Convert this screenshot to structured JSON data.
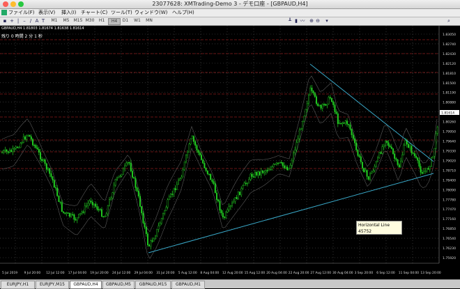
{
  "window": {
    "title": "23077628: XMTrading-Demo 3 - デモ口座 - [GBPAUD,H4]"
  },
  "menu": [
    {
      "label": "ファイル(F)"
    },
    {
      "label": "表示(V)"
    },
    {
      "label": "挿入(I)"
    },
    {
      "label": "チャート(C)"
    },
    {
      "label": "ツール(T)"
    },
    {
      "label": "ウィンドウ(W)"
    },
    {
      "label": "ヘルプ(H)"
    }
  ],
  "toolbar": {
    "timeframes": [
      "M1",
      "M5",
      "M15",
      "M30",
      "H1",
      "H4",
      "D1",
      "W1",
      "MN"
    ],
    "active_timeframe": "H4"
  },
  "chart": {
    "symbol_info": "GBPAUD,H4  1.81803  1.81674  1.81638  1.81614",
    "countdown": "残り 0 時間 2 分 1 秒",
    "price_labels": [
      "1.83050",
      "1.82740",
      "1.82430",
      "1.82120",
      "1.81810",
      "1.81500",
      "1.81190",
      "1.80880",
      "1.80570",
      "1.80260",
      "1.79950",
      "1.79640",
      "1.79330",
      "1.79020",
      "1.78710",
      "1.78400",
      "1.78090",
      "1.77780",
      "1.77470",
      "1.77160",
      "1.76850",
      "1.76540",
      "1.76230",
      "1.75920"
    ],
    "time_labels": [
      "5 Jul 2019",
      "9 Jul 20:00",
      "12 Jul 12:00",
      "17 Jul 04:00",
      "19 Jul 20:00",
      "24 Jul 12:00",
      "29 Jul 04:00",
      "31 Jul 20:00",
      "5 Aug 12:00",
      "8 Aug 04:00",
      "12 Aug 20:00",
      "15 Aug 12:00",
      "20 Aug 04:00",
      "22 Aug 20:00",
      "27 Aug 12:00",
      "30 Aug 04:00",
      "3 Sep 20:00",
      "6 Sep 12:00",
      "11 Sep 04:00",
      "13 Sep 20:00"
    ],
    "bid_label": "1.81614",
    "tooltip": {
      "name": "Horizontal Line 45752",
      "value": "1.77106"
    }
  },
  "tabs": [
    {
      "label": "EURJPY,H1",
      "active": false
    },
    {
      "label": "EURJPY,M15",
      "active": false
    },
    {
      "label": "GBPAUD,H4",
      "active": true
    },
    {
      "label": "GBPAUD,M5",
      "active": false
    },
    {
      "label": "GBPAUD,M15",
      "active": false
    },
    {
      "label": "GBPAUD,M1",
      "active": false
    }
  ],
  "colors": {
    "candle": "#22cc22",
    "trendline": "#39a9c9",
    "grid": "#505050",
    "hline": "#8a1c1c",
    "background": "#000000"
  }
}
